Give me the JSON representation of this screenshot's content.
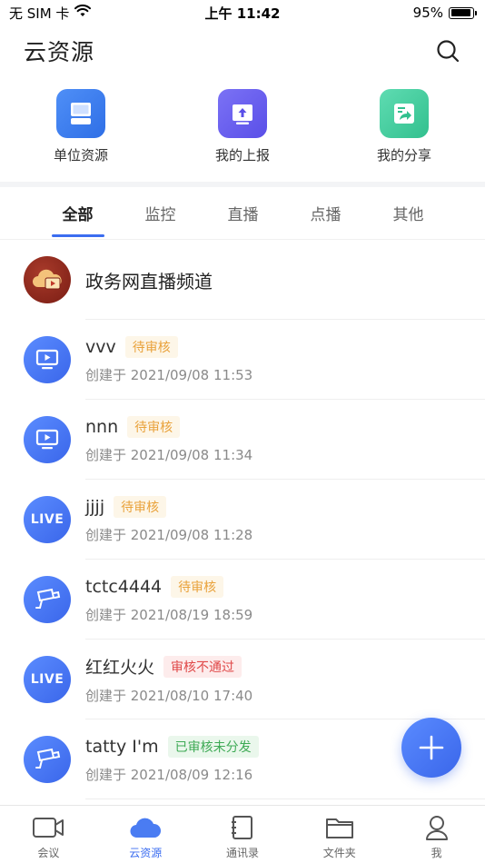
{
  "status_bar": {
    "carrier": "无 SIM 卡",
    "time": "上午 11:42",
    "battery": "95%",
    "battery_level": 0.95
  },
  "header": {
    "title": "云资源"
  },
  "quick_entries": [
    {
      "label": "单位资源",
      "icon": "storage-icon",
      "color": "#3d7cf0"
    },
    {
      "label": "我的上报",
      "icon": "upload-icon",
      "color": "#6b63f0"
    },
    {
      "label": "我的分享",
      "icon": "share-icon",
      "color": "#3fcfa0"
    }
  ],
  "tabs": [
    {
      "label": "全部",
      "active": true
    },
    {
      "label": "监控",
      "active": false
    },
    {
      "label": "直播",
      "active": false
    },
    {
      "label": "点播",
      "active": false
    },
    {
      "label": "其他",
      "active": false
    }
  ],
  "list": [
    {
      "name": "政务网直播频道",
      "icon": "cloud-video-icon",
      "status": "",
      "created": ""
    },
    {
      "name": "vvv",
      "icon": "screen-play-icon",
      "status": "待审核",
      "status_type": "pending",
      "created": "创建于 2021/09/08 11:53"
    },
    {
      "name": "nnn",
      "icon": "screen-play-icon",
      "status": "待审核",
      "status_type": "pending",
      "created": "创建于 2021/09/08 11:34"
    },
    {
      "name": "jjjj",
      "icon": "live-icon",
      "icon_text": "LIVE",
      "status": "待审核",
      "status_type": "pending",
      "created": "创建于 2021/09/08 11:28"
    },
    {
      "name": "tctc4444",
      "icon": "camera-icon",
      "status": "待审核",
      "status_type": "pending",
      "created": "创建于 2021/08/19 18:59"
    },
    {
      "name": "红红火火",
      "icon": "live-icon",
      "icon_text": "LIVE",
      "status": "审核不通过",
      "status_type": "rejected",
      "created": "创建于 2021/08/10 17:40"
    },
    {
      "name": "tatty I'm",
      "icon": "camera-icon",
      "status": "已审核未分发",
      "status_type": "approved",
      "created": "创建于 2021/08/09 12:16"
    }
  ],
  "bottom_nav": [
    {
      "label": "会议",
      "icon": "video-camera-icon",
      "active": false
    },
    {
      "label": "云资源",
      "icon": "cloud-icon",
      "active": true
    },
    {
      "label": "通讯录",
      "icon": "contacts-icon",
      "active": false
    },
    {
      "label": "文件夹",
      "icon": "folder-icon",
      "active": false
    },
    {
      "label": "我",
      "icon": "user-icon",
      "active": false
    }
  ],
  "colors": {
    "accent": "#3b6df0",
    "pending": "#e9a23b",
    "rejected": "#e04848",
    "approved": "#3eaa55"
  }
}
